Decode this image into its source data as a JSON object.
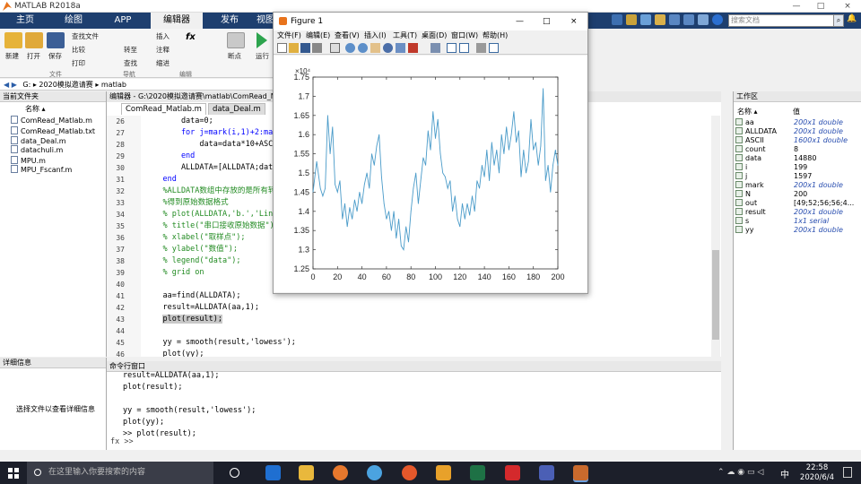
{
  "app": {
    "title": "MATLAB R2018a"
  },
  "window_controls": [
    "—",
    "□",
    "×"
  ],
  "tabs": [
    "主页",
    "绘图",
    "APP",
    "编辑器",
    "发布",
    "视图"
  ],
  "search": {
    "placeholder": "搜索文档"
  },
  "ribbon": {
    "new_label": "新建",
    "open_label": "打开",
    "save_label": "保存",
    "find_files": "查找文件",
    "compare": "比较",
    "print": "打印",
    "goto": "转至",
    "find": "查找",
    "insert": "插入",
    "comment": "注释",
    "indent": "缩进",
    "breakpoint": "断点",
    "run": "运行",
    "sec_file": "文件",
    "sec_nav": "导航",
    "sec_edit": "编辑",
    "sec_bp": "断点"
  },
  "address": {
    "path": [
      "G:",
      "2020模拟邀请赛",
      "matlab"
    ]
  },
  "current_folder": {
    "title": "当前文件夹",
    "col": "名称 ▴",
    "files": [
      "ComRead_Matlab.m",
      "ComRead_Matlab.txt",
      "data_Deal.m",
      "datachuli.m",
      "MPU.m",
      "MPU_Fscanf.m"
    ]
  },
  "details": {
    "title": "详细信息",
    "hint": "选择文件以查看详细信息"
  },
  "editor": {
    "header": "编辑器 - G:\\2020模拟邀请赛\\matlab\\ComRead_M",
    "tabs": [
      "ComRead_Matlab.m",
      "data_Deal.m"
    ],
    "lines": [
      {
        "n": "26",
        "t": "        data=0;"
      },
      {
        "n": "27",
        "t": "        for j=mark(i,1)+2:mark(i+1,1"
      },
      {
        "n": "28",
        "t": "            data=data*10+ASCII(j,1)-"
      },
      {
        "n": "29",
        "t": "        end"
      },
      {
        "n": "30",
        "t": "        ALLDATA=[ALLDATA;data];"
      },
      {
        "n": "31",
        "t": "    end"
      },
      {
        "n": "32",
        "t": "    %ALLDATA数组中存放的是所有转换出来"
      },
      {
        "n": "33",
        "t": "    %得到原始数据格式"
      },
      {
        "n": "34",
        "t": "    % plot(ALLDATA,'b.','LineWidth',"
      },
      {
        "n": "35",
        "t": "    % title(\"串口接收原始数据\");"
      },
      {
        "n": "36",
        "t": "    % xlabel(\"取样点\");"
      },
      {
        "n": "37",
        "t": "    % ylabel(\"数值\");"
      },
      {
        "n": "38",
        "t": "    % legend(\"data\");"
      },
      {
        "n": "39",
        "t": "    % grid on"
      },
      {
        "n": "40",
        "t": ""
      },
      {
        "n": "41",
        "t": "    aa=find(ALLDATA);"
      },
      {
        "n": "42",
        "t": "    result=ALLDATA(aa,1);"
      },
      {
        "n": "43",
        "t": "    plot(result);"
      },
      {
        "n": "44",
        "t": ""
      },
      {
        "n": "45",
        "t": "    yy = smooth(result,'lowess');"
      },
      {
        "n": "46",
        "t": "    plot(yy);"
      }
    ]
  },
  "command_window": {
    "title": "命令行窗口",
    "lines": [
      "result=ALLDATA(aa,1);",
      "plot(result);",
      "",
      "yy = smooth(result,'lowess');",
      "plot(yy);",
      ">> plot(result);"
    ],
    "prompt": "fx >>"
  },
  "workspace": {
    "title": "工作区",
    "col_name": "名称 ▴",
    "col_value": "值",
    "vars": [
      {
        "name": "aa",
        "value": "200x1 double",
        "italic": true
      },
      {
        "name": "ALLDATA",
        "value": "200x1 double",
        "italic": true
      },
      {
        "name": "ASCII",
        "value": "1600x1 double",
        "italic": true
      },
      {
        "name": "count",
        "value": "8",
        "italic": false
      },
      {
        "name": "data",
        "value": "14880",
        "italic": false
      },
      {
        "name": "i",
        "value": "199",
        "italic": false
      },
      {
        "name": "j",
        "value": "1597",
        "italic": false
      },
      {
        "name": "mark",
        "value": "200x1 double",
        "italic": true
      },
      {
        "name": "N",
        "value": "200",
        "italic": false
      },
      {
        "name": "out",
        "value": "[49;52;56;56;4...",
        "italic": false
      },
      {
        "name": "result",
        "value": "200x1 double",
        "italic": true
      },
      {
        "name": "s",
        "value": "1x1 serial",
        "italic": true
      },
      {
        "name": "yy",
        "value": "200x1 double",
        "italic": true
      }
    ]
  },
  "figure": {
    "title": "Figure 1",
    "menu": [
      "文件(F)",
      "编辑(E)",
      "查看(V)",
      "插入(I)",
      "工具(T)",
      "桌面(D)",
      "窗口(W)",
      "帮助(H)"
    ],
    "controls": [
      "—",
      "□",
      "×"
    ]
  },
  "chart_data": {
    "type": "line",
    "exponent_label": "×10⁴",
    "xlim": [
      0,
      200
    ],
    "ylim": [
      1.25,
      1.75
    ],
    "xticks": [
      "0",
      "20",
      "40",
      "60",
      "80",
      "100",
      "120",
      "140",
      "160",
      "180",
      "200"
    ],
    "yticks": [
      "1.25",
      "1.3",
      "1.35",
      "1.4",
      "1.45",
      "1.5",
      "1.55",
      "1.6",
      "1.65",
      "1.7",
      "1.75"
    ],
    "color": "#4a9bc9",
    "x": [
      0,
      3,
      6,
      8,
      10,
      12,
      14,
      16,
      18,
      20,
      22,
      24,
      26,
      28,
      30,
      32,
      34,
      36,
      38,
      40,
      42,
      44,
      46,
      48,
      50,
      52,
      54,
      56,
      58,
      60,
      62,
      64,
      66,
      68,
      70,
      72,
      74,
      76,
      78,
      80,
      82,
      84,
      86,
      88,
      90,
      92,
      94,
      96,
      98,
      100,
      102,
      104,
      106,
      108,
      110,
      112,
      114,
      116,
      118,
      120,
      122,
      124,
      126,
      128,
      130,
      132,
      134,
      136,
      138,
      140,
      142,
      144,
      146,
      148,
      150,
      152,
      154,
      156,
      158,
      160,
      162,
      164,
      166,
      168,
      170,
      172,
      174,
      176,
      178,
      180,
      182,
      184,
      186,
      188,
      190,
      192,
      194,
      196,
      198,
      200
    ],
    "y": [
      1.45,
      1.53,
      1.46,
      1.44,
      1.46,
      1.65,
      1.55,
      1.62,
      1.47,
      1.45,
      1.48,
      1.38,
      1.42,
      1.36,
      1.41,
      1.38,
      1.43,
      1.4,
      1.45,
      1.42,
      1.47,
      1.5,
      1.46,
      1.55,
      1.52,
      1.57,
      1.6,
      1.49,
      1.42,
      1.38,
      1.4,
      1.35,
      1.4,
      1.33,
      1.38,
      1.31,
      1.3,
      1.36,
      1.32,
      1.4,
      1.46,
      1.5,
      1.42,
      1.48,
      1.54,
      1.52,
      1.61,
      1.56,
      1.66,
      1.59,
      1.64,
      1.55,
      1.5,
      1.49,
      1.46,
      1.48,
      1.4,
      1.44,
      1.38,
      1.36,
      1.42,
      1.38,
      1.42,
      1.39,
      1.44,
      1.4,
      1.48,
      1.46,
      1.52,
      1.49,
      1.56,
      1.48,
      1.58,
      1.52,
      1.56,
      1.5,
      1.6,
      1.55,
      1.62,
      1.56,
      1.6,
      1.66,
      1.58,
      1.61,
      1.49,
      1.56,
      1.5,
      1.53,
      1.64,
      1.56,
      1.58,
      1.52,
      1.57,
      1.72,
      1.48,
      1.52,
      1.45,
      1.52,
      1.56,
      1.52
    ]
  },
  "taskbar": {
    "search_placeholder": "在这里输入你要搜索的内容",
    "time": "22:58",
    "date": "2020/6/4",
    "ime": "中"
  }
}
